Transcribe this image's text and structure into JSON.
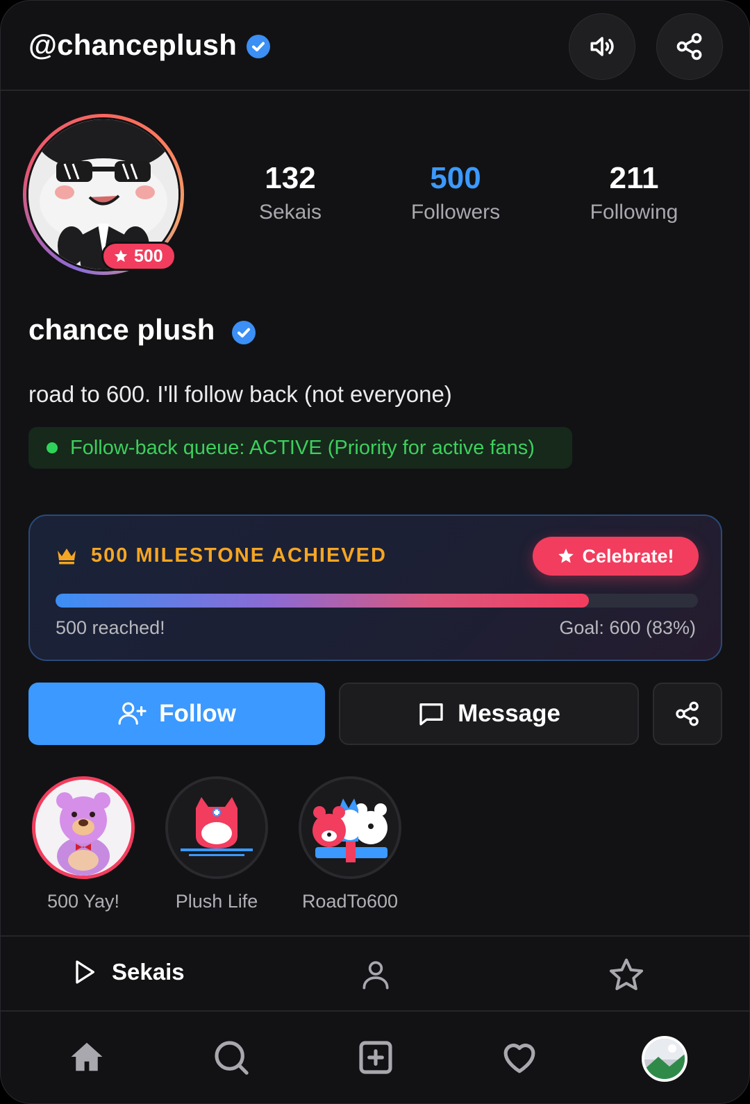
{
  "header": {
    "handle": "@chanceplush"
  },
  "profile": {
    "badge_count": "500",
    "stats": [
      {
        "value": "132",
        "label": "Sekais"
      },
      {
        "value": "500",
        "label": "Followers"
      },
      {
        "value": "211",
        "label": "Following"
      }
    ],
    "display_name": "chance plush",
    "bio": "road to 600. I'll follow back (not everyone)",
    "queue_status": "Follow-back queue: ACTIVE (Priority for active fans)"
  },
  "milestone": {
    "title": "500 MILESTONE ACHIEVED",
    "celebrate_label": "Celebrate!",
    "progress": 0.83,
    "left_text": "500 reached!",
    "right_text": "Goal: 600 (83%)"
  },
  "actions": {
    "follow_label": "Follow",
    "message_label": "Message"
  },
  "highlights": [
    {
      "label": "500 Yay!"
    },
    {
      "label": "Plush Life"
    },
    {
      "label": "RoadTo600"
    }
  ],
  "tabs": {
    "sekais_label": "Sekais"
  },
  "colors": {
    "accent_blue": "#3b99ff",
    "accent_pink": "#f23d5e",
    "milestone_gold": "#f5a623",
    "queue_green": "#3ecf5d",
    "background": "#121214"
  },
  "icons": {
    "header": [
      "verified-badge-icon",
      "speaker-icon",
      "share-icon"
    ],
    "nav": [
      "home-icon",
      "search-icon",
      "add-icon",
      "heart-icon",
      "profile-avatar"
    ],
    "tabs": [
      "play-icon",
      "user-icon",
      "star-icon"
    ]
  }
}
